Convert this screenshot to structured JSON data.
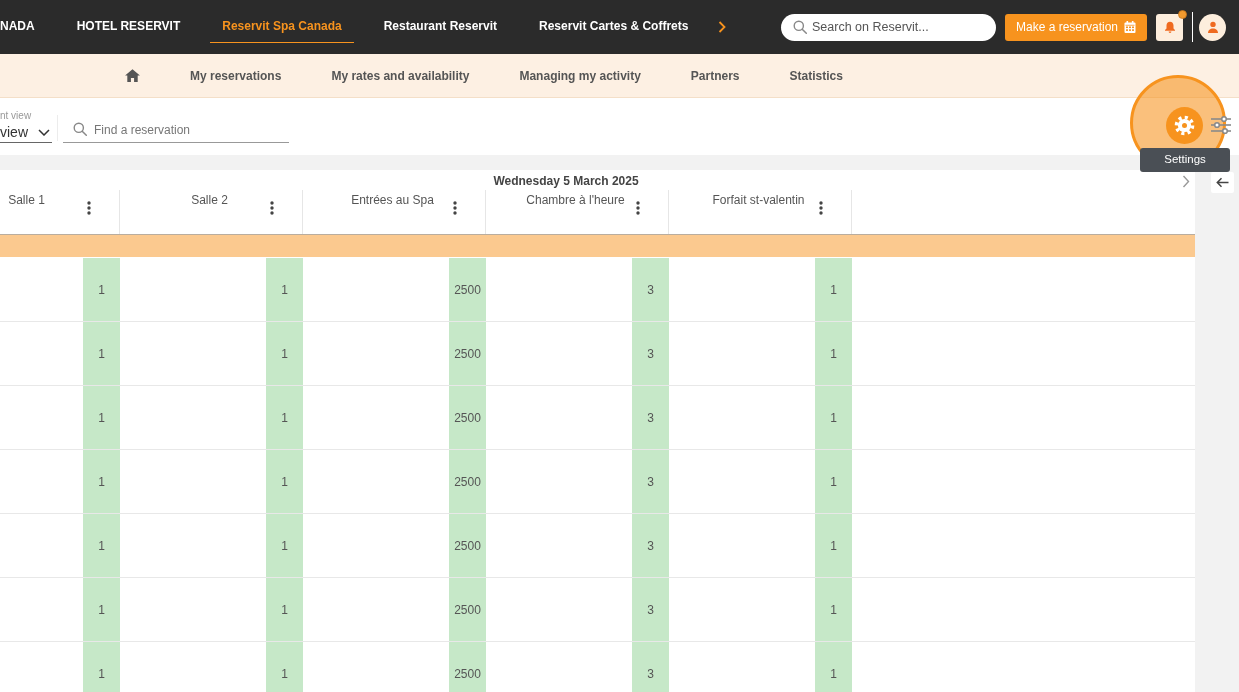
{
  "top_nav": {
    "items": [
      {
        "label": "NADA",
        "selected": false
      },
      {
        "label": "HOTEL RESERVIT",
        "selected": false
      },
      {
        "label": "Reservit Spa Canada",
        "selected": true
      },
      {
        "label": "Restaurant Reservit",
        "selected": false
      },
      {
        "label": "Reservit Cartes & Coffrets",
        "selected": false
      }
    ],
    "search": {
      "placeholder": "Search on Reservit..."
    },
    "reserve_button": {
      "label": "Make a reservation"
    },
    "notifications": {
      "unread": true
    }
  },
  "sub_nav": {
    "items": [
      {
        "label": "My reservations",
        "selected": false
      },
      {
        "label": "My rates and availability",
        "selected": false
      },
      {
        "label": "Managing my activity",
        "selected": false
      },
      {
        "label": "Partners",
        "selected": false
      },
      {
        "label": "Statistics",
        "selected": false
      }
    ]
  },
  "toolbar": {
    "view_select": {
      "label": "nt view",
      "value": "view"
    },
    "search": {
      "placeholder": "Find a reservation"
    },
    "settings": {
      "highlighted": true,
      "tooltip": "Settings"
    }
  },
  "planning": {
    "date": "Wednesday 5 March 2025",
    "columns": [
      "Salle 1",
      "Salle 2",
      "Entrées au Spa",
      "Chambre à l'heure",
      "Forfait st-valentin"
    ],
    "rows": [
      [
        "1",
        "1",
        "2500",
        "3",
        "1"
      ],
      [
        "1",
        "1",
        "2500",
        "3",
        "1"
      ],
      [
        "1",
        "1",
        "2500",
        "3",
        "1"
      ],
      [
        "1",
        "1",
        "2500",
        "3",
        "1"
      ],
      [
        "1",
        "1",
        "2500",
        "3",
        "1"
      ],
      [
        "1",
        "1",
        "2500",
        "3",
        "1"
      ],
      [
        "1",
        "1",
        "2500",
        "3",
        "1"
      ]
    ]
  }
}
